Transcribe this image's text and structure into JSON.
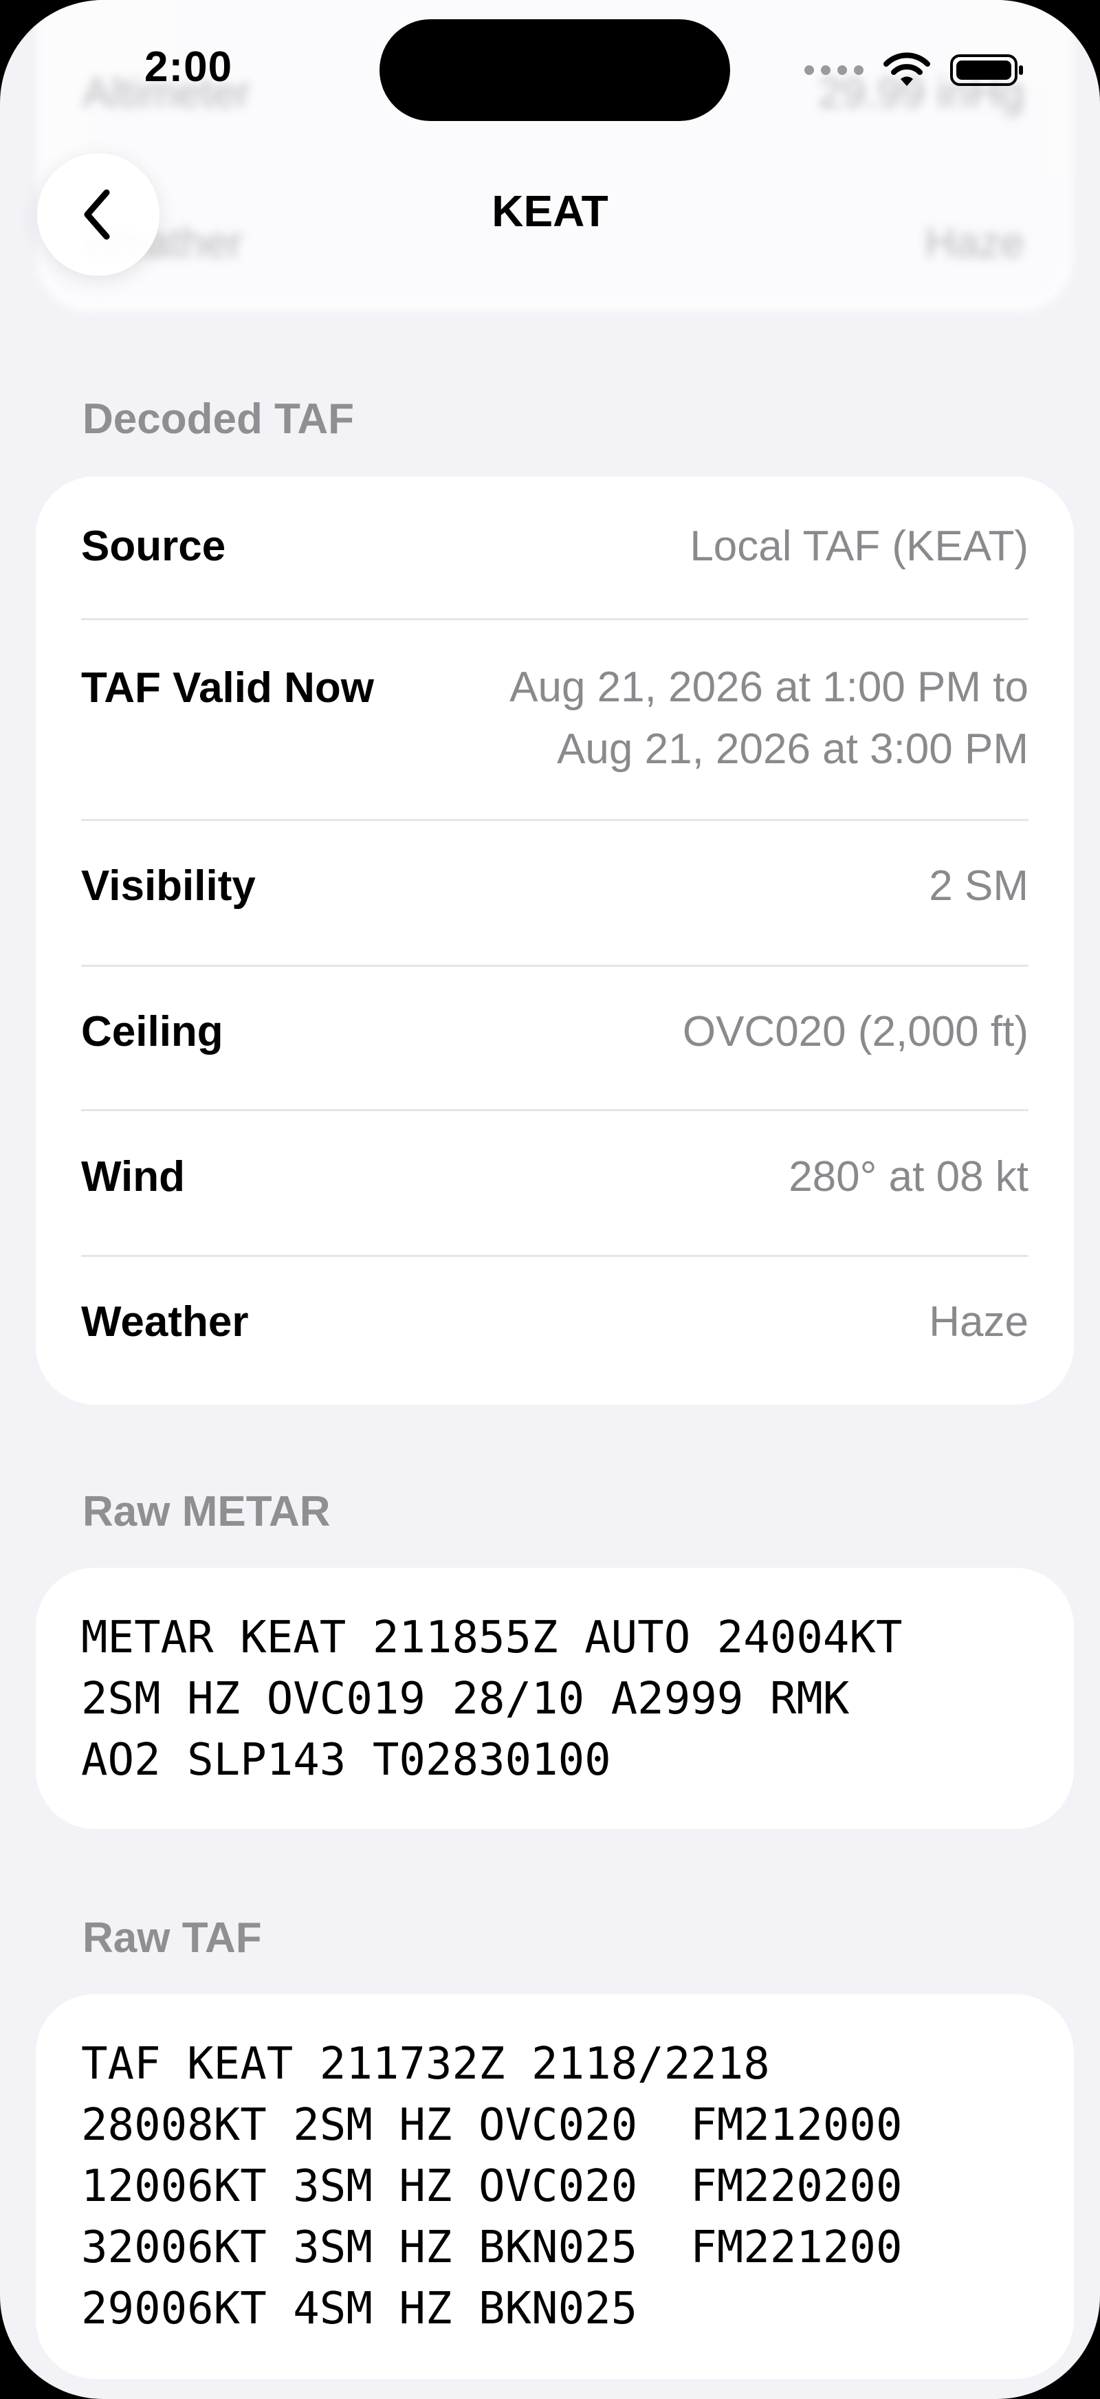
{
  "status_bar": {
    "time": "2:00",
    "icons": [
      "cellular-dots-icon",
      "wifi-icon",
      "battery-icon"
    ]
  },
  "background_blurred": {
    "row1_label": "Altimeter",
    "row1_value": "29.99 inHg",
    "row2_label": "Weather",
    "row2_value": "Haze"
  },
  "nav": {
    "back_icon": "chevron-left-icon",
    "title": "KEAT"
  },
  "decoded_taf": {
    "header": "Decoded TAF",
    "rows": [
      {
        "label": "Source",
        "value": "Local TAF (KEAT)"
      },
      {
        "label": "TAF Valid Now",
        "value": "Aug 21, 2026 at 1:00 PM to\nAug 21, 2026 at 3:00 PM"
      },
      {
        "label": "Visibility",
        "value": "2 SM"
      },
      {
        "label": "Ceiling",
        "value": "OVC020 (2,000 ft)"
      },
      {
        "label": "Wind",
        "value": "280° at 08 kt"
      },
      {
        "label": "Weather",
        "value": "Haze"
      }
    ]
  },
  "raw_metar": {
    "header": "Raw METAR",
    "text": "METAR KEAT 211855Z AUTO 24004KT\n2SM HZ OVC019 28/10 A2999 RMK\nAO2 SLP143 T02830100"
  },
  "raw_taf": {
    "header": "Raw TAF",
    "text": "TAF KEAT 211732Z 2118/2218\n28008KT 2SM HZ OVC020  FM212000\n12006KT 3SM HZ OVC020  FM220200\n32006KT 3SM HZ BKN025  FM221200\n29006KT 4SM HZ BKN025"
  }
}
